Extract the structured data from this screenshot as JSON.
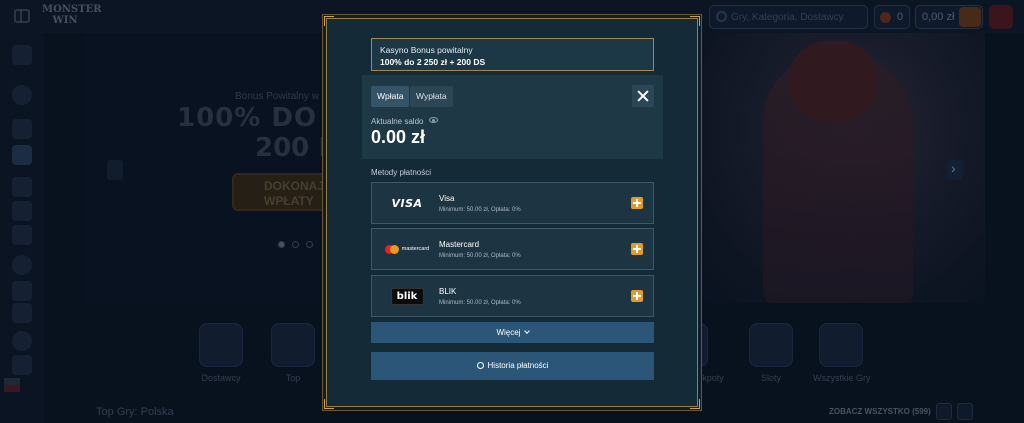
{
  "background": {
    "logo_text": "MONSTER WIN",
    "search_placeholder": "Gry, Kategoria, Dostawcy",
    "points": "0",
    "balance": "0,00 zł",
    "hero": {
      "line1": "Bonus Powitalny w K",
      "line2": "100% DO 2 2",
      "line3": "200 DS",
      "cta": "DOKONAJ WPŁATY"
    },
    "categories": [
      {
        "label": "Dostawcy"
      },
      {
        "label": "Top"
      },
      {
        "label": "Jackpoty"
      },
      {
        "label": "Sloty"
      },
      {
        "label": "Wszystkie Gry"
      }
    ],
    "section_title": "Top Gry: Polska",
    "see_all": "ZOBACZ WSZYSTKO (599)"
  },
  "modal": {
    "bonus_line1": "Kasyno Bonus powitalny",
    "bonus_line2": "100% do 2 250 zł + 200 DS",
    "tab_deposit": "Wpłata",
    "tab_withdraw": "Wypłata",
    "balance_label": "Aktualne saldo",
    "balance_value": "0.00 zł",
    "methods_label": "Metody płatności",
    "methods": [
      {
        "logo": "VISA",
        "name": "Visa",
        "meta": "Minimum: 50.00 zł, Opłata: 0%"
      },
      {
        "logo": "mastercard",
        "name": "Mastercard",
        "meta": "Minimum: 50.00 zł, Opłata: 0%"
      },
      {
        "logo": "blik",
        "name": "BLIK",
        "meta": "Minimum: 50.00 zł, Opłata: 0%"
      }
    ],
    "more_label": "Więcej",
    "history_label": "Historia płatności"
  },
  "colors": {
    "modal_bg": "#152a37",
    "gold_border": "#9a7d43",
    "button_blue": "#2c5678",
    "plus_orange": "#e39a2d"
  }
}
